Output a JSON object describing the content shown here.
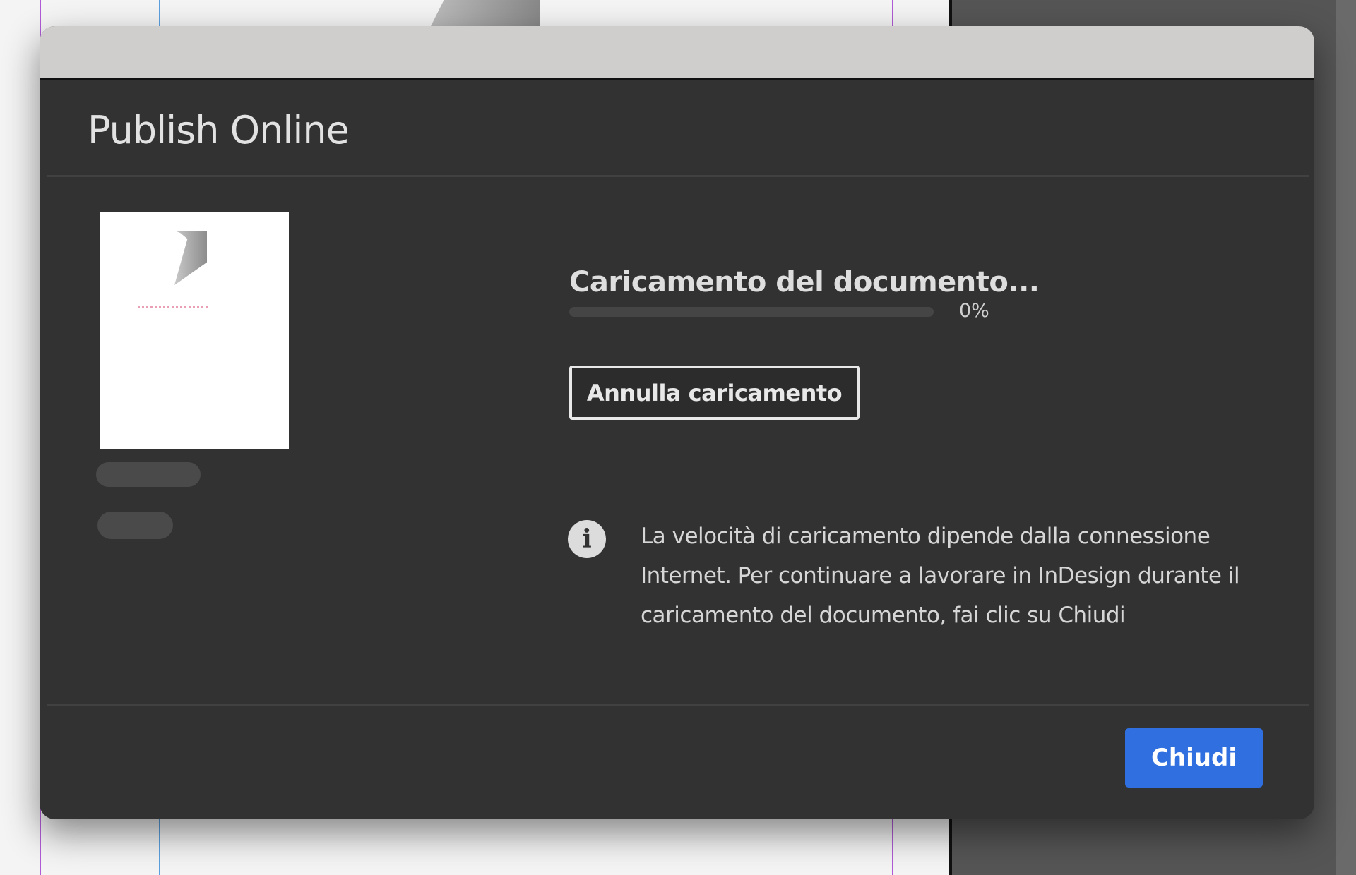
{
  "dialog": {
    "title": "Publish Online",
    "status_heading": "Caricamento del documento...",
    "progress": {
      "percent": 0,
      "label": "0%"
    },
    "cancel_label": "Annulla caricamento",
    "info_icon": "info-icon",
    "info_text": "La velocità di caricamento dipende dalla connessione Internet. Per continuare a lavorare in InDesign durante il caricamento del documento, fai clic su Chiudi",
    "close_label": "Chiudi"
  },
  "colors": {
    "accent": "#2f6fdf",
    "dialog_bg": "#323232",
    "titlebar": "#cfcecc"
  }
}
